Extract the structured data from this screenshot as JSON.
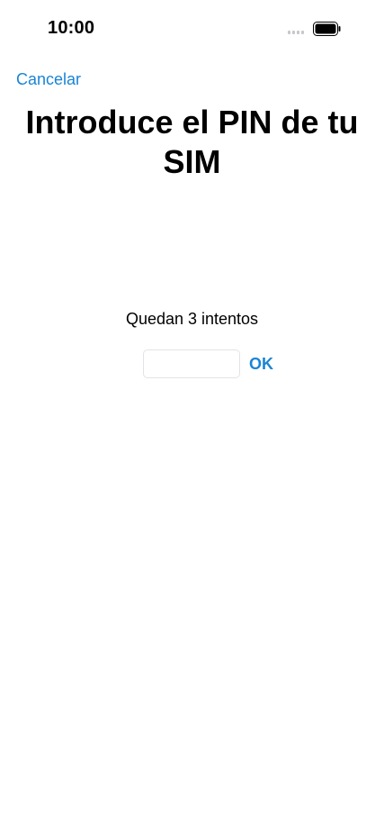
{
  "status_bar": {
    "time": "10:00",
    "signal_icon": "cellular-signal-icon",
    "battery_icon": "battery-full-icon"
  },
  "nav": {
    "cancel_label": "Cancelar"
  },
  "title": "Introduce el PIN de tu SIM",
  "attempts": "Quedan 3 intentos",
  "pin_field": {
    "value": "",
    "placeholder": ""
  },
  "ok_label": "OK",
  "colors": {
    "accent": "#1a84d6",
    "text": "#000000",
    "background": "#ffffff",
    "field_border": "#e3e3e6"
  }
}
